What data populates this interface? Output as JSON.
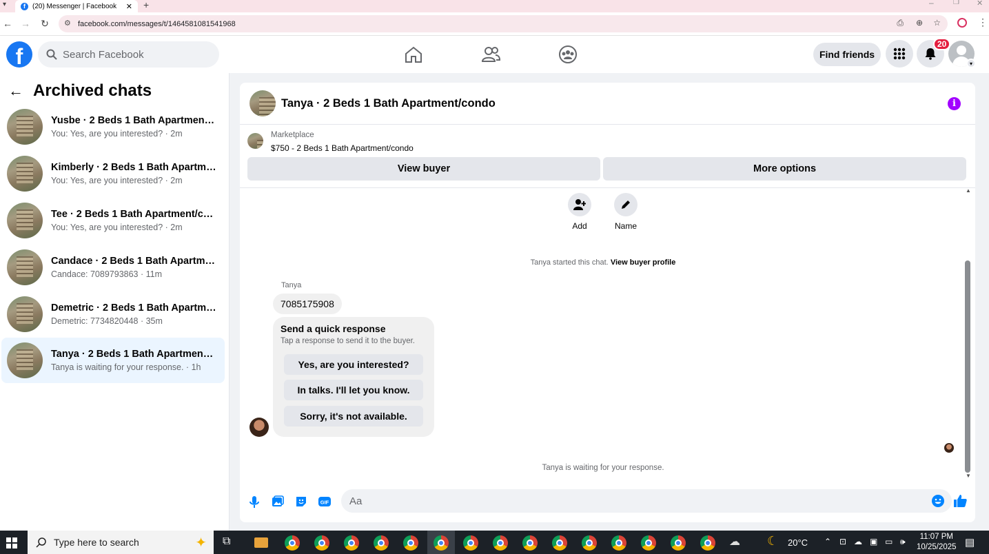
{
  "browser": {
    "tab_title": "(20) Messenger | Facebook",
    "url": "facebook.com/messages/t/1464581081541968"
  },
  "header": {
    "search_placeholder": "Search Facebook",
    "find_friends": "Find friends",
    "notification_count": "20"
  },
  "sidebar": {
    "title": "Archived chats",
    "chats": [
      {
        "name": "Yusbe · 2 Beds 1 Bath Apartment/c...",
        "preview": "You: Yes, are you interested? · 2m"
      },
      {
        "name": "Kimberly · 2 Beds 1 Bath Apartmen...",
        "preview": "You: Yes, are you interested? · 2m"
      },
      {
        "name": "Tee · 2 Beds 1 Bath Apartment/con...",
        "preview": "You: Yes, are you interested? · 2m"
      },
      {
        "name": "Candace · 2 Beds 1 Bath Apartmen...",
        "preview": "Candace: 7089793863 · 11m"
      },
      {
        "name": "Demetric · 2 Beds 1 Bath Apartme...",
        "preview": "Demetric: 7734820448 · 35m"
      },
      {
        "name": "Tanya · 2 Beds 1 Bath Apartment/c...",
        "preview": "Tanya is waiting for your response. · 1h"
      }
    ]
  },
  "conversation": {
    "title": "Tanya · 2 Beds 1 Bath Apartment/condo",
    "marketplace_label": "Marketplace",
    "listing": "$750 - 2 Beds 1 Bath Apartment/condo",
    "view_buyer": "View buyer",
    "more_options": "More options",
    "add_label": "Add",
    "name_label": "Name",
    "started_text": "Tanya started this chat.",
    "view_buyer_profile": "View buyer profile",
    "sender": "Tanya",
    "message": "7085175908",
    "quick_title": "Send a quick response",
    "quick_sub": "Tap a response to send it to the buyer.",
    "quick_responses": [
      "Yes, are you interested?",
      "In talks. I'll let you know.",
      "Sorry, it's not available."
    ],
    "waiting_text": "Tanya is waiting for your response.",
    "composer_placeholder": "Aa"
  },
  "taskbar": {
    "search_placeholder": "Type here to search",
    "temperature": "20°C",
    "time": "11:07 PM",
    "date": "10/25/2025"
  },
  "colors": {
    "fb_blue": "#1877f2",
    "active_chat_bg": "#ebf5ff",
    "info_purple": "#a200ff",
    "badge_red": "#e41e3f"
  }
}
